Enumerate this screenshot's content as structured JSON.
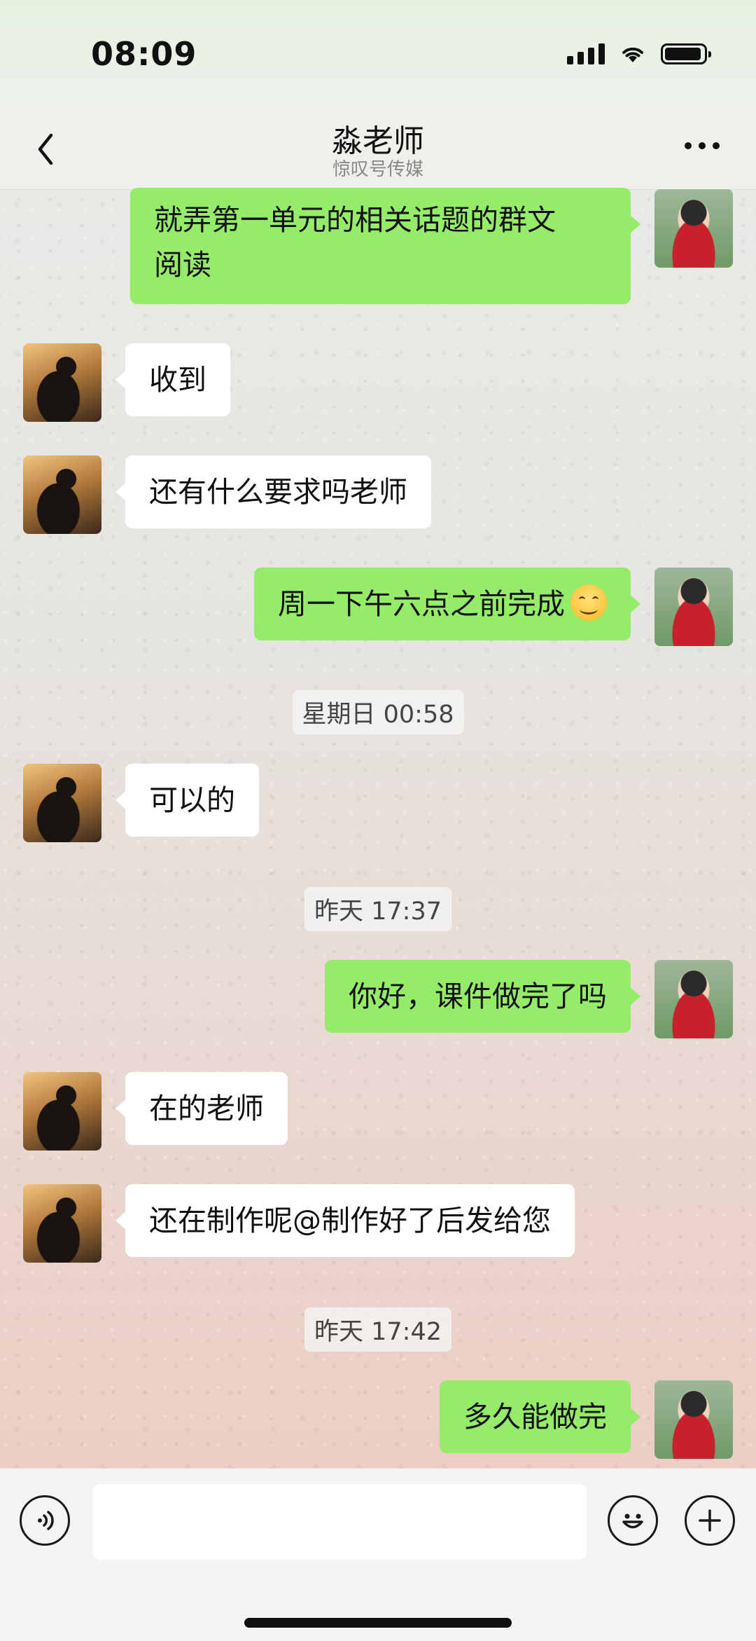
{
  "status": {
    "time": "08:09"
  },
  "header": {
    "title": "淼老师",
    "subtitle": "惊叹号传媒"
  },
  "messages": [
    {
      "from": "me",
      "text": "就弄第一单元的相关话题的群文\n阅读"
    },
    {
      "from": "them",
      "text": "收到"
    },
    {
      "from": "them",
      "text": "还有什么要求吗老师"
    },
    {
      "from": "me",
      "text": "周一下午六点之前完成",
      "emoji": "smiling-face"
    },
    {
      "timestamp": "星期日 00:58"
    },
    {
      "from": "them",
      "text": "可以的"
    },
    {
      "timestamp": "昨天 17:37"
    },
    {
      "from": "me",
      "text": "你好，课件做完了吗"
    },
    {
      "from": "them",
      "text": "在的老师"
    },
    {
      "from": "them",
      "text": "还在制作呢@制作好了后发给您"
    },
    {
      "timestamp": "昨天 17:42"
    },
    {
      "from": "me",
      "text": "多久能做完"
    }
  ],
  "input": {
    "value": ""
  },
  "icons": [
    "back-chevron-icon",
    "more-icon",
    "voice-icon",
    "emoji-icon",
    "plus-icon",
    "signal-icon",
    "wifi-icon",
    "battery-icon"
  ],
  "colors": {
    "my_bubble": "#95ec69",
    "their_bubble": "#ffffff"
  }
}
